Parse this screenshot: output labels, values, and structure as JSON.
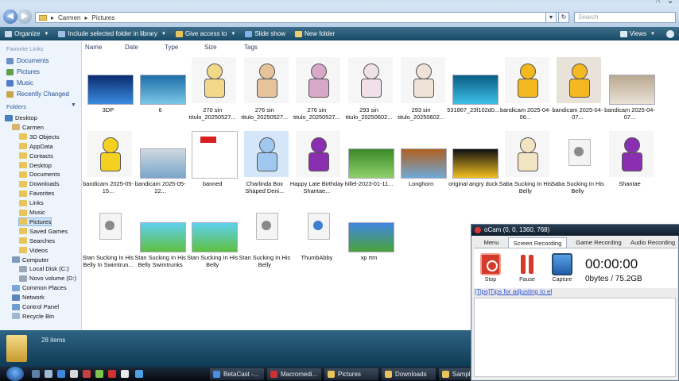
{
  "explorer": {
    "breadcrumb": [
      "Carmen",
      "Pictures"
    ],
    "search_placeholder": "Search",
    "toolbar": {
      "organize": "Organize",
      "include": "Include selected folder in library",
      "give_access": "Give access to",
      "slideshow": "Slide show",
      "new_folder": "New folder",
      "views": "Views"
    },
    "columns": [
      "Name",
      "Date",
      "Type",
      "Size",
      "Tags"
    ],
    "favorite_links_title": "Favorite Links",
    "favorites": [
      {
        "label": "Documents",
        "color": "#6c8fc7"
      },
      {
        "label": "Pictures",
        "color": "#5ea04f"
      },
      {
        "label": "Music",
        "color": "#4f7cc9"
      },
      {
        "label": "Recently Changed",
        "color": "#c9a44f"
      }
    ],
    "folders_title": "Folders",
    "tree": [
      {
        "label": "Desktop",
        "indent": 0,
        "color": "#4a7ebf"
      },
      {
        "label": "Carmen",
        "indent": 1,
        "color": "#d9b56a"
      },
      {
        "label": "3D Objects",
        "indent": 2,
        "color": "#e8c45a"
      },
      {
        "label": "AppData",
        "indent": 2,
        "color": "#e8c45a"
      },
      {
        "label": "Contacts",
        "indent": 2,
        "color": "#e8c45a"
      },
      {
        "label": "Desktop",
        "indent": 2,
        "color": "#e8c45a"
      },
      {
        "label": "Documents",
        "indent": 2,
        "color": "#e8c45a"
      },
      {
        "label": "Downloads",
        "indent": 2,
        "color": "#e8c45a"
      },
      {
        "label": "Favorites",
        "indent": 2,
        "color": "#e8c45a"
      },
      {
        "label": "Links",
        "indent": 2,
        "color": "#e8c45a"
      },
      {
        "label": "Music",
        "indent": 2,
        "color": "#e8c45a"
      },
      {
        "label": "Pictures",
        "indent": 2,
        "color": "#e8c45a",
        "selected": true
      },
      {
        "label": "Saved Games",
        "indent": 2,
        "color": "#e8c45a"
      },
      {
        "label": "Searches",
        "indent": 2,
        "color": "#e8c45a"
      },
      {
        "label": "Videos",
        "indent": 2,
        "color": "#e8c45a"
      },
      {
        "label": "Computer",
        "indent": 1,
        "color": "#7c9cc0"
      },
      {
        "label": "Local Disk (C:)",
        "indent": 2,
        "color": "#9aa7b4"
      },
      {
        "label": "Novo volume (D:)",
        "indent": 2,
        "color": "#9aa7b4"
      },
      {
        "label": "Common Places",
        "indent": 1,
        "color": "#7aa6d6"
      },
      {
        "label": "Network",
        "indent": 1,
        "color": "#5b86bf"
      },
      {
        "label": "Control Panel",
        "indent": 1,
        "color": "#6f9ccf"
      },
      {
        "label": "Recycle Bin",
        "indent": 1,
        "color": "#9fb7cf"
      }
    ],
    "items": [
      {
        "label": "3DP",
        "kind": "image",
        "c1": "#0a2b6e",
        "c2": "#3a8de0"
      },
      {
        "label": "6",
        "kind": "image",
        "c1": "#1f6fa8",
        "c2": "#7cc6e8"
      },
      {
        "label": "270 sin titulo_20250527...",
        "kind": "character",
        "c1": "#f2d98a",
        "c2": "#f6f6f6"
      },
      {
        "label": "276 sin titulo_20250527...",
        "kind": "character",
        "c1": "#e7c39b",
        "c2": "#f6f6f6"
      },
      {
        "label": "276 sin titulo_20250527...",
        "kind": "character",
        "c1": "#d8a8c8",
        "c2": "#f6f6f6"
      },
      {
        "label": "293 sin titulo_20250602...",
        "kind": "character",
        "c1": "#f0e0e8",
        "c2": "#f6f6f6"
      },
      {
        "label": "293 sin titulo_20250602...",
        "kind": "character",
        "c1": "#efe3d8",
        "c2": "#f6f6f6"
      },
      {
        "label": "531867_23f102d0...",
        "kind": "image",
        "c1": "#0a5e86",
        "c2": "#3dc0e6"
      },
      {
        "label": "bandicam 2025-04-06...",
        "kind": "character",
        "c1": "#f4b820",
        "c2": "#f6f6f6"
      },
      {
        "label": "bandicam 2025-04-07...",
        "kind": "character",
        "c1": "#f4b820",
        "c2": "#e8e2d8"
      },
      {
        "label": "bandicam 2025-04-07...",
        "kind": "image",
        "c1": "#b9a891",
        "c2": "#e9e2d6"
      },
      {
        "label": "bandicam 2025-05-15...",
        "kind": "character",
        "c1": "#f4d020",
        "c2": "#f6f6f6"
      },
      {
        "label": "bandicam 2025-05-22...",
        "kind": "image",
        "c1": "#cfd8e0",
        "c2": "#79a6c9"
      },
      {
        "label": "banned",
        "kind": "document",
        "c1": "#d92020",
        "c2": "#ffffff"
      },
      {
        "label": "Charlinda Box Shaped Deni...",
        "kind": "character",
        "c1": "#9fc7f0",
        "c2": "#d4e6f7"
      },
      {
        "label": "Happy Late Birthday Shantae...",
        "kind": "character",
        "c1": "#8a2fb0",
        "c2": "#f6f6f6"
      },
      {
        "label": "hillel-2023-01-11...",
        "kind": "image",
        "c1": "#3b8a2a",
        "c2": "#8fd06a"
      },
      {
        "label": "Longhorn",
        "kind": "image",
        "c1": "#b0601f",
        "c2": "#6fa9d8"
      },
      {
        "label": "original angry duck",
        "kind": "image",
        "c1": "#101010",
        "c2": "#f4c020"
      },
      {
        "label": "Saba Sucking In His Belly",
        "kind": "character",
        "c1": "#f2e3c2",
        "c2": "#f6f6f6"
      },
      {
        "label": "Saba Sucking In His Belly",
        "kind": "generic",
        "c1": "#e8e8e8",
        "c2": "#f8f8f8"
      },
      {
        "label": "Shantae",
        "kind": "character",
        "c1": "#8a2fb0",
        "c2": "#f6f6f6"
      },
      {
        "label": "Stan Sucking In His Belly In Swimtrun...",
        "kind": "generic",
        "c1": "#e8e8e8",
        "c2": "#f8f8f8"
      },
      {
        "label": "Stan Sucking In His Belly Swimtrunks",
        "kind": "image",
        "c1": "#5fd0f0",
        "c2": "#5fc040"
      },
      {
        "label": "Stan Sucking In His Belly",
        "kind": "image",
        "c1": "#5fd0f0",
        "c2": "#5fc040"
      },
      {
        "label": "Stan Sucking In His Belly",
        "kind": "generic",
        "c1": "#e8e8e8",
        "c2": "#f8f8f8"
      },
      {
        "label": "ThumbAbby",
        "kind": "generic-blue",
        "c1": "#e8e8e8",
        "c2": "#3a7fd0"
      },
      {
        "label": "xp rtm",
        "kind": "image",
        "c1": "#3f86e0",
        "c2": "#4aa33a"
      }
    ],
    "status": "28 items"
  },
  "taskbar": {
    "buttons": [
      {
        "label": "BetaCast -...",
        "color": "#4a90e2"
      },
      {
        "label": "Macromedi...",
        "color": "#d03030"
      },
      {
        "label": "Pictures",
        "color": "#e8c45a"
      },
      {
        "label": "Downloads",
        "color": "#e8c45a"
      },
      {
        "label": "Sample",
        "color": "#e8c45a"
      }
    ]
  },
  "ocam": {
    "title": "oCam (0, 0, 1360, 768)",
    "tabs": [
      "Menu",
      "Screen Recording",
      "Game Recording",
      "Audio Recording"
    ],
    "active_tab": "Screen Recording",
    "buttons": {
      "stop": "Stop",
      "pause": "Pause",
      "capture": "Capture"
    },
    "timer": "00:00:00",
    "bytes": "0bytes / 75.2GB",
    "tips": "[Tips]Tips for adjusting to el"
  }
}
